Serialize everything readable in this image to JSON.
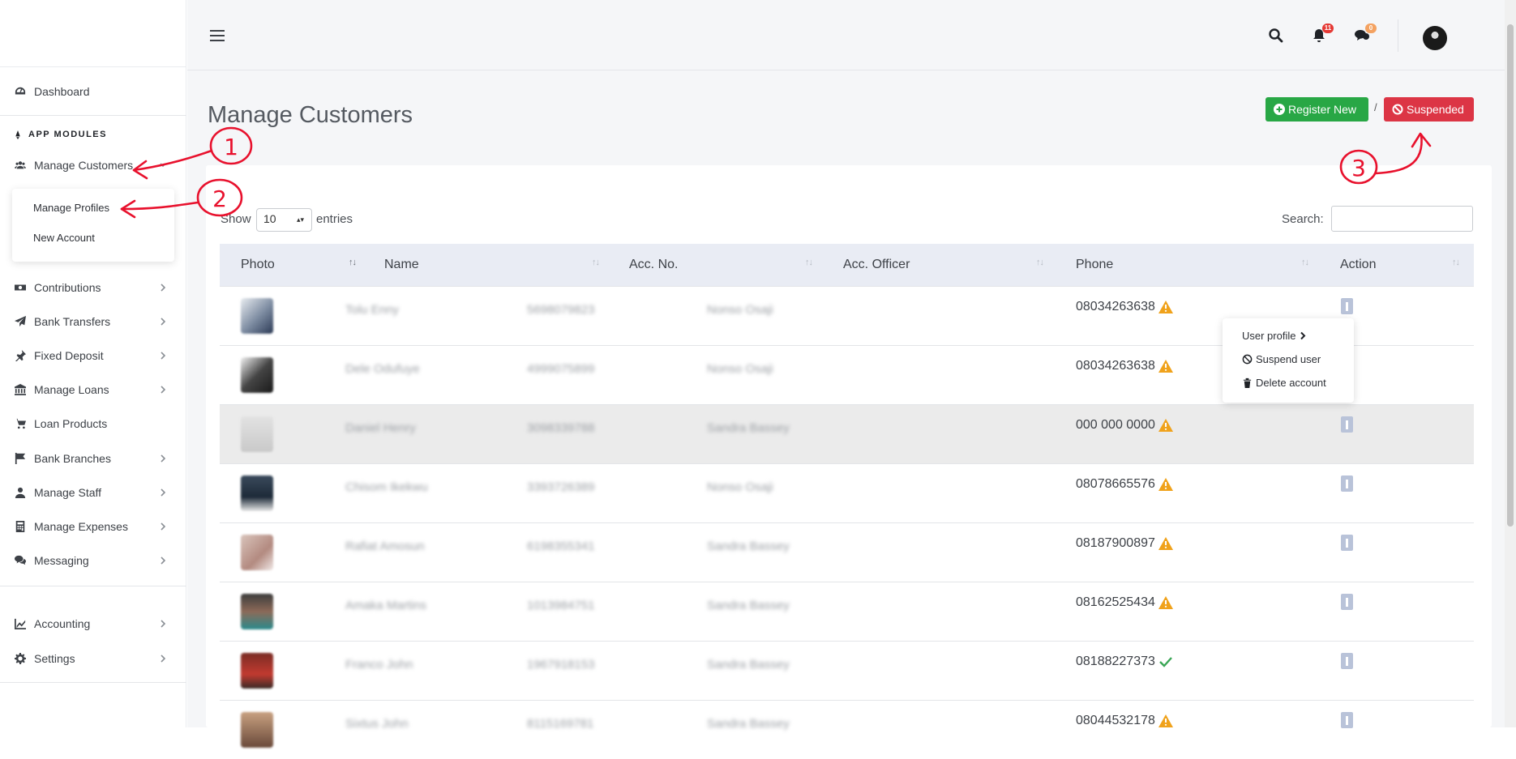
{
  "sidebar": {
    "items": [
      {
        "label": "Dashboard",
        "icon": "dashboard-icon"
      },
      {
        "label": "Manage Customers",
        "icon": "users-icon"
      },
      {
        "label": "Contributions",
        "icon": "money-icon"
      },
      {
        "label": "Bank Transfers",
        "icon": "paper-plane-icon"
      },
      {
        "label": "Fixed Deposit",
        "icon": "pin-icon"
      },
      {
        "label": "Manage Loans",
        "icon": "bank-icon"
      },
      {
        "label": "Loan Products",
        "icon": "cart-icon"
      },
      {
        "label": "Bank Branches",
        "icon": "flag-icon"
      },
      {
        "label": "Manage Staff",
        "icon": "user-icon"
      },
      {
        "label": "Manage Expenses",
        "icon": "calculator-icon"
      },
      {
        "label": "Messaging",
        "icon": "comments-icon"
      },
      {
        "label": "Accounting",
        "icon": "chart-icon"
      },
      {
        "label": "Settings",
        "icon": "cog-icon"
      }
    ],
    "section_header": "APP MODULES",
    "submenu": [
      "Manage Profiles",
      "New Account"
    ]
  },
  "topbar": {
    "notifications_count": "11",
    "messages_count": "0"
  },
  "page": {
    "title": "Manage Customers",
    "register_label": "Register New",
    "separator": "/",
    "suspended_label": "Suspended"
  },
  "table_controls": {
    "show_label": "Show",
    "entries_value": "10",
    "entries_label": "entries",
    "search_label": "Search:"
  },
  "table": {
    "columns": [
      "Photo",
      "Name",
      "Acc. No.",
      "Acc. Officer",
      "Phone",
      "Action"
    ],
    "rows": [
      {
        "name": "Tolu Enny",
        "acc": "5698079823",
        "officer": "Nonso Osaji",
        "phone": "08034263638",
        "status": "warning"
      },
      {
        "name": "Dele Odufuye",
        "acc": "4999075899",
        "officer": "Nonso Osaji",
        "phone": "08034263638",
        "status": "warning"
      },
      {
        "name": "Daniel Henry",
        "acc": "3098339788",
        "officer": "Sandra Bassey",
        "phone": "000 000 0000",
        "status": "warning"
      },
      {
        "name": "Chisom Ikekwu",
        "acc": "3393726389",
        "officer": "Nonso Osaji",
        "phone": "08078665576",
        "status": "warning"
      },
      {
        "name": "Rafiat Amosun",
        "acc": "6198355341",
        "officer": "Sandra Bassey",
        "phone": "08187900897",
        "status": "warning"
      },
      {
        "name": "Amaka Martins",
        "acc": "1013984751",
        "officer": "Sandra Bassey",
        "phone": "08162525434",
        "status": "warning"
      },
      {
        "name": "Franco John",
        "acc": "1967918153",
        "officer": "Sandra Bassey",
        "phone": "08188227373",
        "status": "ok"
      },
      {
        "name": "Sixtus John",
        "acc": "8115169781",
        "officer": "Sandra Bassey",
        "phone": "08044532178",
        "status": "warning"
      }
    ]
  },
  "context_menu": {
    "items": [
      "User profile",
      "Suspend user",
      "Delete account"
    ]
  },
  "annotations": [
    "1",
    "2",
    "3"
  ],
  "colors": {
    "green": "#28a745",
    "red": "#dc3545",
    "warning": "#f0a21b",
    "ok": "#3aa655",
    "annotation": "#e8112d"
  }
}
